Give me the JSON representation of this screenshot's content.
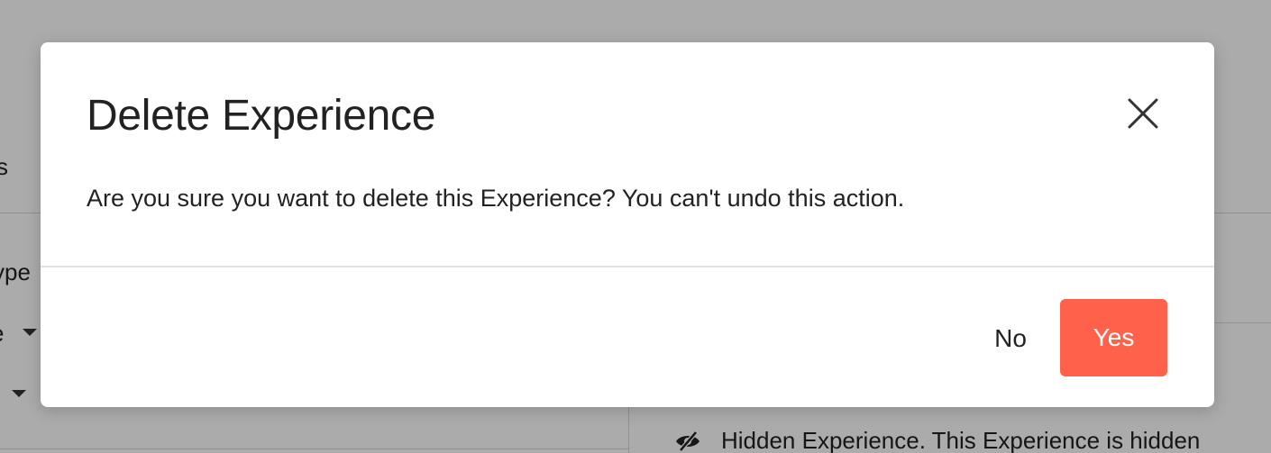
{
  "background": {
    "partial_labels": [
      "s",
      "ype",
      "e"
    ],
    "hidden_notice": "Hidden Experience. This Experience is hidden"
  },
  "modal": {
    "title": "Delete Experience",
    "message": "Are you sure you want to delete this Experience? You can't undo this action.",
    "no_label": "No",
    "yes_label": "Yes"
  },
  "colors": {
    "primary_action": "#ff614a",
    "overlay": "rgba(0,0,0,0.33)",
    "text": "#222222"
  },
  "icons": {
    "close": "close-icon",
    "hidden": "eye-slash-icon",
    "caret": "caret-down-icon"
  }
}
